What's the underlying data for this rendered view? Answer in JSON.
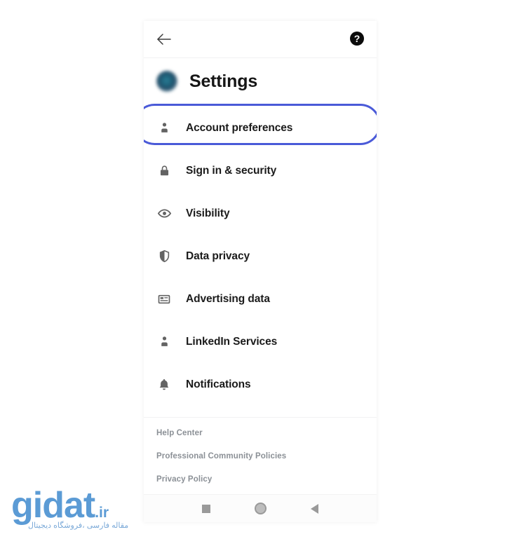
{
  "app": {
    "screen_title": "Settings",
    "background_color": "#ffffff",
    "accent_color": "#4a5ad8"
  },
  "top_bar": {
    "back_icon": "back-arrow-icon",
    "back_label": "Back",
    "help_icon": "help-circle-icon",
    "help_label": "?"
  },
  "header": {
    "avatar_icon": "profile-avatar",
    "title": "Settings"
  },
  "menu": {
    "highlighted_item": "Account preferences",
    "items": [
      {
        "label": "Account preferences",
        "icon": "person-icon",
        "highlighted": true
      },
      {
        "label": "Sign in & security",
        "icon": "lock-icon",
        "highlighted": false
      },
      {
        "label": "Visibility",
        "icon": "eye-icon",
        "highlighted": false
      },
      {
        "label": "Data privacy",
        "icon": "shield-icon",
        "highlighted": false
      },
      {
        "label": "Advertising data",
        "icon": "ad-card-icon",
        "highlighted": false
      },
      {
        "label": "LinkedIn Services",
        "icon": "person-icon",
        "highlighted": false
      },
      {
        "label": "Notifications",
        "icon": "bell-icon",
        "highlighted": false
      }
    ]
  },
  "footer": {
    "links": [
      {
        "label": "Help Center"
      },
      {
        "label": "Professional Community Policies"
      },
      {
        "label": "Privacy Policy"
      }
    ]
  },
  "android_nav": {
    "recents_icon": "square-icon",
    "recents_label": "Recents",
    "home_icon": "circle-icon",
    "home_label": "Home",
    "back_icon": "triangle-left-icon",
    "back_label": "Back"
  },
  "watermark": {
    "name": "gidat",
    "tld": ".ir",
    "subtitle": "مقاله فارسی ،فروشگاه دیجیتال",
    "color": "#5b9bd5"
  }
}
